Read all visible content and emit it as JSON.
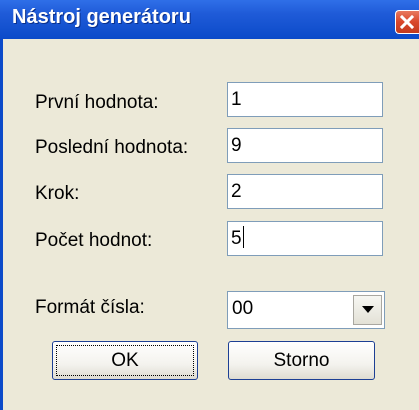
{
  "window": {
    "title": "Nástroj generátoru"
  },
  "fields": [
    {
      "label": "První hodnota:",
      "value": "1"
    },
    {
      "label": "Poslední hodnota:",
      "value": "9"
    },
    {
      "label": "Krok:",
      "value": "2"
    },
    {
      "label": "Počet hodnot:",
      "value": "5"
    }
  ],
  "format": {
    "label": "Formát čísla:",
    "value": "00"
  },
  "buttons": {
    "ok": "OK",
    "cancel": "Storno"
  },
  "icons": {
    "close": "close-icon",
    "dropdown": "chevron-down-icon"
  },
  "colors": {
    "titlebar": "#0b4ac9",
    "close": "#d9472b",
    "dialog_bg": "#ece9d8"
  }
}
